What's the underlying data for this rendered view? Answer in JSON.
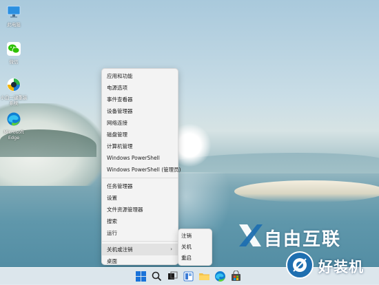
{
  "desktop": {
    "icons": [
      {
        "label": "此电脑",
        "icon": "computer-icon"
      },
      {
        "label": "微信",
        "icon": "wechat-icon"
      },
      {
        "label": "小白一键重装系统",
        "icon": "reinstall-helper-icon"
      },
      {
        "label": "Microsoft Edge",
        "icon": "edge-icon"
      }
    ]
  },
  "context_menu": {
    "items": [
      "应用和功能",
      "电源选项",
      "事件查看器",
      "设备管理器",
      "网络连接",
      "磁盘管理",
      "计算机管理",
      "Windows PowerShell",
      "Windows PowerShell (管理员)",
      "任务管理器",
      "设置",
      "文件资源管理器",
      "搜索",
      "运行",
      "关机或注销",
      "桌面"
    ],
    "submenu_chevron": "›"
  },
  "submenu": {
    "items": [
      "注销",
      "关机",
      "重启"
    ]
  },
  "taskbar": {
    "icons": [
      "start-icon",
      "search-icon",
      "task-view-icon",
      "widgets-icon",
      "file-explorer-icon",
      "edge-icon",
      "store-icon"
    ]
  },
  "watermarks": {
    "brand_text": "自由互联",
    "site_text": "好装机"
  },
  "colors": {
    "menu_bg": "#f3f3f3",
    "highlight": "#e2e2e2",
    "start_blue": "#1a73d9",
    "folder_yellow": "#f2c14b"
  }
}
